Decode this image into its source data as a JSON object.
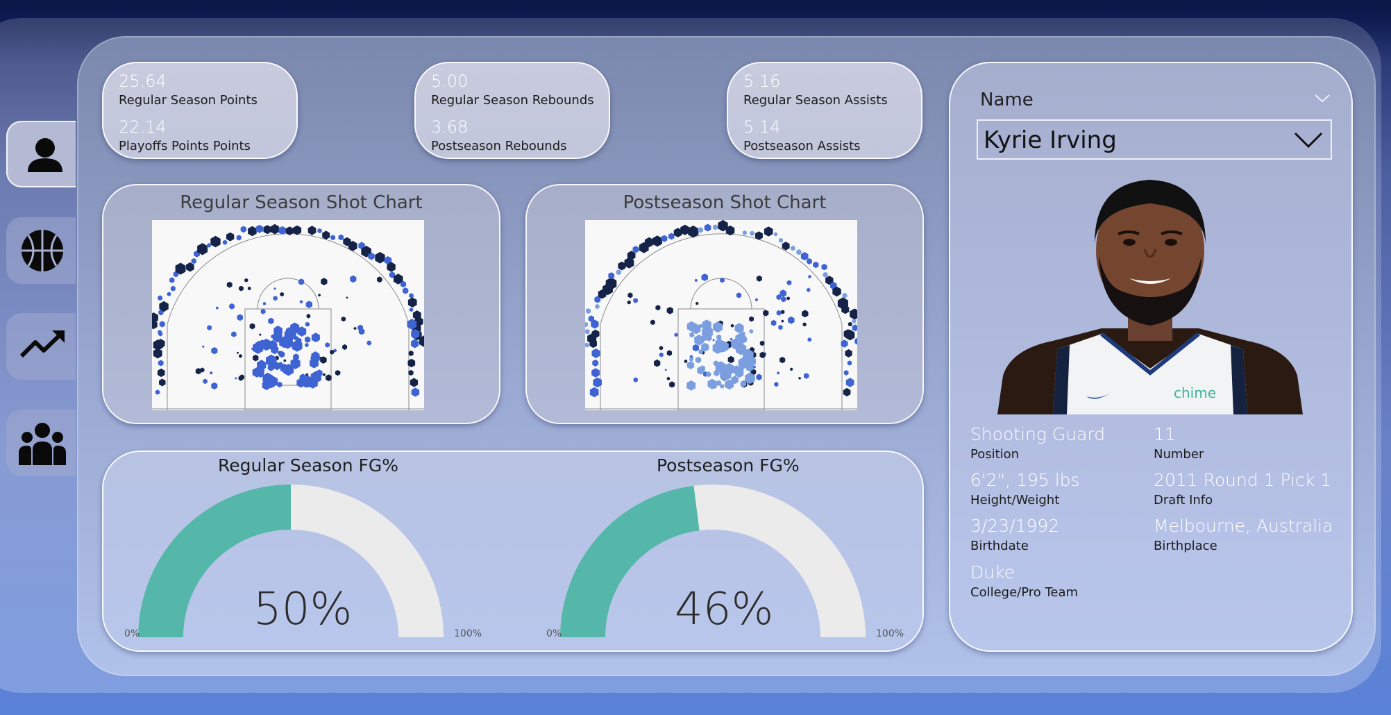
{
  "kpis": {
    "points": {
      "regular_value": "25.64",
      "regular_label": "Regular Season Points",
      "playoff_value": "22.14",
      "playoff_label": "Playoffs Points Points"
    },
    "rebounds": {
      "regular_value": "5.00",
      "regular_label": "Regular Season Rebounds",
      "playoff_value": "3.68",
      "playoff_label": "Postseason Rebounds"
    },
    "assists": {
      "regular_value": "5.16",
      "regular_label": "Regular Season Assists",
      "playoff_value": "5.14",
      "playoff_label": "Postseason Assists"
    }
  },
  "shot_charts": {
    "regular_title": "Regular Season Shot Chart",
    "post_title": "Postseason Shot Chart"
  },
  "gauges": {
    "regular": {
      "title": "Regular Season FG%",
      "value_text": "50%",
      "value": 0.5,
      "min": "0%",
      "max": "100%"
    },
    "post": {
      "title": "Postseason FG%",
      "value_text": "46%",
      "value": 0.46,
      "min": "0%",
      "max": "100%"
    }
  },
  "colors": {
    "gauge_fill": "#55b6aa",
    "gauge_track": "#ebebeb",
    "shot_dark": "#142347",
    "shot_blue": "#3e63d3",
    "shot_light": "#7a9ee0"
  },
  "nav": {
    "items": [
      {
        "name": "player-profile",
        "icon": "person-icon"
      },
      {
        "name": "basketball",
        "icon": "basketball-icon"
      },
      {
        "name": "trends",
        "icon": "trending-up-icon"
      },
      {
        "name": "team",
        "icon": "group-icon"
      }
    ]
  },
  "profile": {
    "slicer_label": "Name",
    "selected_player": "Kyrie Irving",
    "fields": [
      {
        "value": "Shooting Guard",
        "label": "Position"
      },
      {
        "value": "11",
        "label": "Number"
      },
      {
        "value": "6'2\", 195 lbs",
        "label": "Height/Weight"
      },
      {
        "value": "2011 Round 1 Pick 1",
        "label": "Draft Info"
      },
      {
        "value": "3/23/1992",
        "label": "Birthdate"
      },
      {
        "value": "Melbourne, Australia",
        "label": "Birthplace"
      },
      {
        "value": "Duke",
        "label": "College/Pro Team"
      }
    ],
    "jersey_sponsor": "chime"
  }
}
